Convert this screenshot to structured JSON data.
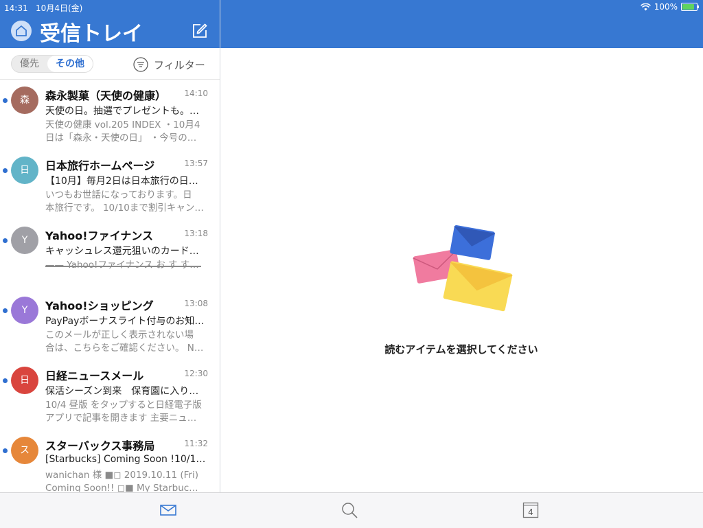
{
  "status_bar": {
    "time": "14:31",
    "date": "10月4日(金)",
    "battery": "100%"
  },
  "header": {
    "title": "受信トレイ"
  },
  "segment": {
    "focused": "優先",
    "other": "その他",
    "selected": "その他"
  },
  "filter": {
    "label": "フィルター"
  },
  "emails": [
    {
      "initial": "森",
      "color": "#a56b5f",
      "sender": "森永製菓（天使の健康）",
      "time": "14:10",
      "subject": "天使の日。抽選でプレゼントも。…",
      "preview": [
        "天使の健康 vol.205 INDEX ・10月4",
        "日は「森永・天使の日」 ・今号の…"
      ]
    },
    {
      "initial": "日",
      "color": "#62b4c8",
      "sender": "日本旅行ホームページ",
      "time": "13:57",
      "subject": "【10月】毎月2日は日本旅行の日キ…",
      "preview": [
        "いつもお世話になっております。日",
        "本旅行です。 10/10まで割引キャン…"
      ]
    },
    {
      "initial": "Y",
      "color": "#a0a0a6",
      "sender": "Yahoo!ファイナンス",
      "time": "13:18",
      "subject": "キャッシュレス還元狙いのカード…",
      "preview": [
        "",
        "—— Yahoo!ファイナンス お す す…"
      ]
    },
    {
      "initial": "Y",
      "color": "#9a78d8",
      "sender": "Yahoo!ショッピング",
      "time": "13:08",
      "subject": "PayPayボーナスライト付与のお知…",
      "preview": [
        "このメールが正しく表示されない場",
        "合は、こちらをご確認ください。 N…"
      ]
    },
    {
      "initial": "日",
      "color": "#d9453e",
      "sender": "日経ニュースメール",
      "time": "12:30",
      "subject": "保活シーズン到来　保育園に入り…",
      "preview": [
        "10/4 昼版 をタップすると日経電子版",
        "アプリで記事を開きます 主要ニュ…"
      ]
    },
    {
      "initial": "ス",
      "color": "#e6873a",
      "sender": "スターバックス事務局",
      "time": "11:32",
      "subject": "[Starbucks] Coming Soon !10/11…",
      "preview": [
        "wanichan 様 ■◻ 2019.10.11 (Fri)",
        "Coming Soon!! ◻■ My Starbuc…"
      ]
    }
  ],
  "reading_pane": {
    "empty_text": "読むアイテムを選択してください"
  },
  "tabbar": {
    "calendar_day": "4"
  },
  "colors": {
    "accent": "#3778d2",
    "unread": "#2f6fd0"
  }
}
